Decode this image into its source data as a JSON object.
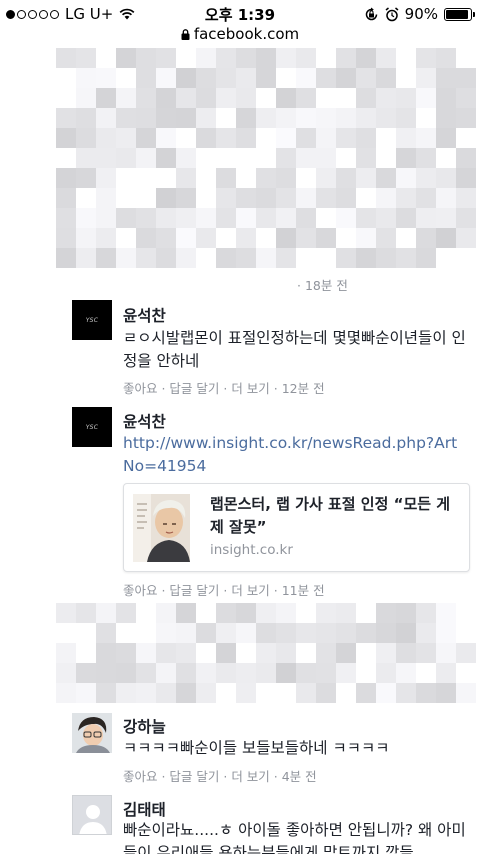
{
  "status_bar": {
    "carrier": "LG U+",
    "time": "오후 1:39",
    "battery": "90%",
    "battery_level": 0.9
  },
  "url_bar": {
    "domain": "facebook.com"
  },
  "comments": [
    {
      "meta": "· 18분 전"
    },
    {
      "author": "윤석찬",
      "avatar_text": "YSC",
      "text": "ㄹㅇ시발랩몬이 표절인정하는데 몇몇빠순이년들이 인정을 안하네",
      "meta": "좋아요 · 답글 달기 · 더 보기 · 12분 전"
    },
    {
      "author": "윤석찬",
      "avatar_text": "YSC",
      "link": "http://www.insight.co.kr/newsRead.php?ArtNo=41954",
      "card_title": "랩몬스터, 랩 가사 표절 인정 “모든 게 제 잘못”",
      "card_domain": "insight.co.kr",
      "meta": "좋아요 · 답글 달기 · 더 보기 · 11분 전"
    },
    {
      "author": "강하늘",
      "text": "ㅋㅋㅋㅋ빠순이들 보들보들하네 ㅋㅋㅋㅋ",
      "meta": "좋아요 · 답글 달기 · 더 보기 · 4분 전"
    },
    {
      "author": "김태태",
      "text": "빠순이라뇨.....ㅎ 아이돌 좋아하면 안됩니까? 왜 아미들이 우리애들 욕하는분들에게 맞트까지 깠들"
    }
  ],
  "colors": {
    "link": "#4b6c9e",
    "meta": "#90949c",
    "text": "#1d2129"
  }
}
